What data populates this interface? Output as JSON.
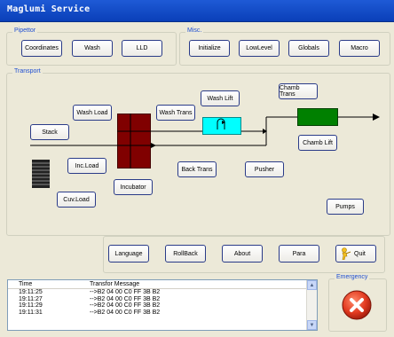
{
  "window": {
    "title": "Maglumi Service"
  },
  "pipettor": {
    "label": "Pipettor",
    "buttons": [
      "Coordinates",
      "Wash",
      "LLD"
    ]
  },
  "misc": {
    "label": "Misc.",
    "buttons": [
      "Initialize",
      "LowLevel",
      "Globals",
      "Macro"
    ]
  },
  "transport": {
    "label": "Transport",
    "buttons": {
      "stack": "Stack",
      "wash_load": "Wash Load",
      "inc_load": "Inc.Load",
      "cuv_load": "Cuv.Load",
      "incubator": "Incubator",
      "wash_trans": "Wash Trans",
      "wash_lift": "Wash Lift",
      "back_trans": "Back Trans",
      "pusher": "Pusher",
      "chamb_trans": "Chamb Trans",
      "chamb_lift": "Chamb Lift",
      "pumps": "Pumps"
    },
    "colors": {
      "incubator": "#800000",
      "wash": "#00ffff",
      "chamber": "#008000"
    }
  },
  "bottom_buttons": [
    "Language",
    "RollBack",
    "About",
    "Para",
    "Quit"
  ],
  "log": {
    "headers": [
      "Time",
      "Transfor Message"
    ],
    "rows": [
      {
        "time": "19:11:25",
        "msg": "-->B2 04 00 C0 FF 3B B2"
      },
      {
        "time": "19:11:27",
        "msg": "-->B2 04 00 C0 FF 3B B2"
      },
      {
        "time": "19:11:29",
        "msg": "-->B2 04 00 C0 FF 3B B2"
      },
      {
        "time": "19:11:31",
        "msg": "-->B2 04 00 C0 FF 3B B2"
      }
    ]
  },
  "emergency": {
    "label": "Emergency",
    "icon": "stop-x-icon"
  }
}
